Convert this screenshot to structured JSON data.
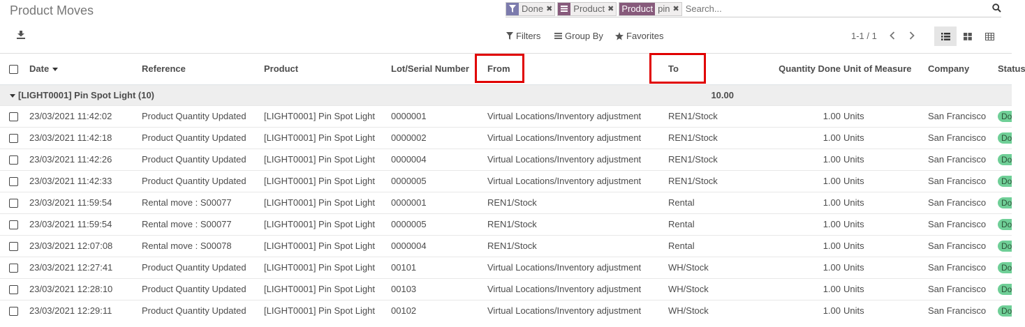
{
  "page": {
    "title": "Product Moves"
  },
  "search": {
    "facets": [
      {
        "icon": "filter-icon",
        "text": "Done"
      },
      {
        "icon": "group-by-icon",
        "text": "Product"
      },
      {
        "label": "Product",
        "text": "pin"
      }
    ],
    "placeholder": "Search..."
  },
  "controls": {
    "filters_label": "Filters",
    "group_by_label": "Group By",
    "favorites_label": "Favorites",
    "pager": "1-1 / 1"
  },
  "table": {
    "columns": [
      "Date",
      "Reference",
      "Product",
      "Lot/Serial Number",
      "From",
      "To",
      "Quantity Done",
      "Unit of Measure",
      "Company",
      "Status"
    ],
    "group": {
      "label": "[LIGHT0001] Pin Spot Light (10)",
      "quantity": "10.00"
    },
    "rows": [
      {
        "date": "23/03/2021 11:42:02",
        "reference": "Product Quantity Updated",
        "product": "[LIGHT0001] Pin Spot Light",
        "lot": "0000001",
        "from": "Virtual Locations/Inventory adjustment",
        "to": "REN1/Stock",
        "qty": "1.00",
        "uom": "Units",
        "company": "San Francisco",
        "status": "Done"
      },
      {
        "date": "23/03/2021 11:42:18",
        "reference": "Product Quantity Updated",
        "product": "[LIGHT0001] Pin Spot Light",
        "lot": "0000002",
        "from": "Virtual Locations/Inventory adjustment",
        "to": "REN1/Stock",
        "qty": "1.00",
        "uom": "Units",
        "company": "San Francisco",
        "status": "Done"
      },
      {
        "date": "23/03/2021 11:42:26",
        "reference": "Product Quantity Updated",
        "product": "[LIGHT0001] Pin Spot Light",
        "lot": "0000004",
        "from": "Virtual Locations/Inventory adjustment",
        "to": "REN1/Stock",
        "qty": "1.00",
        "uom": "Units",
        "company": "San Francisco",
        "status": "Done"
      },
      {
        "date": "23/03/2021 11:42:33",
        "reference": "Product Quantity Updated",
        "product": "[LIGHT0001] Pin Spot Light",
        "lot": "0000005",
        "from": "Virtual Locations/Inventory adjustment",
        "to": "REN1/Stock",
        "qty": "1.00",
        "uom": "Units",
        "company": "San Francisco",
        "status": "Done"
      },
      {
        "date": "23/03/2021 11:59:54",
        "reference": "Rental move : S00077",
        "product": "[LIGHT0001] Pin Spot Light",
        "lot": "0000001",
        "from": "REN1/Stock",
        "to": "Rental",
        "qty": "1.00",
        "uom": "Units",
        "company": "San Francisco",
        "status": "Done"
      },
      {
        "date": "23/03/2021 11:59:54",
        "reference": "Rental move : S00077",
        "product": "[LIGHT0001] Pin Spot Light",
        "lot": "0000005",
        "from": "REN1/Stock",
        "to": "Rental",
        "qty": "1.00",
        "uom": "Units",
        "company": "San Francisco",
        "status": "Done"
      },
      {
        "date": "23/03/2021 12:07:08",
        "reference": "Rental move : S00078",
        "product": "[LIGHT0001] Pin Spot Light",
        "lot": "0000004",
        "from": "REN1/Stock",
        "to": "Rental",
        "qty": "1.00",
        "uom": "Units",
        "company": "San Francisco",
        "status": "Done"
      },
      {
        "date": "23/03/2021 12:27:41",
        "reference": "Product Quantity Updated",
        "product": "[LIGHT0001] Pin Spot Light",
        "lot": "00101",
        "from": "Virtual Locations/Inventory adjustment",
        "to": "WH/Stock",
        "qty": "1.00",
        "uom": "Units",
        "company": "San Francisco",
        "status": "Done"
      },
      {
        "date": "23/03/2021 12:28:10",
        "reference": "Product Quantity Updated",
        "product": "[LIGHT0001] Pin Spot Light",
        "lot": "00103",
        "from": "Virtual Locations/Inventory adjustment",
        "to": "WH/Stock",
        "qty": "1.00",
        "uom": "Units",
        "company": "San Francisco",
        "status": "Done"
      },
      {
        "date": "23/03/2021 12:29:11",
        "reference": "Product Quantity Updated",
        "product": "[LIGHT0001] Pin Spot Light",
        "lot": "00102",
        "from": "Virtual Locations/Inventory adjustment",
        "to": "WH/Stock",
        "qty": "1.00",
        "uom": "Units",
        "company": "San Francisco",
        "status": "Done"
      }
    ]
  },
  "colors": {
    "accent": "#875a7b",
    "status_done": "#6fcf97",
    "highlight": "#e00000"
  }
}
